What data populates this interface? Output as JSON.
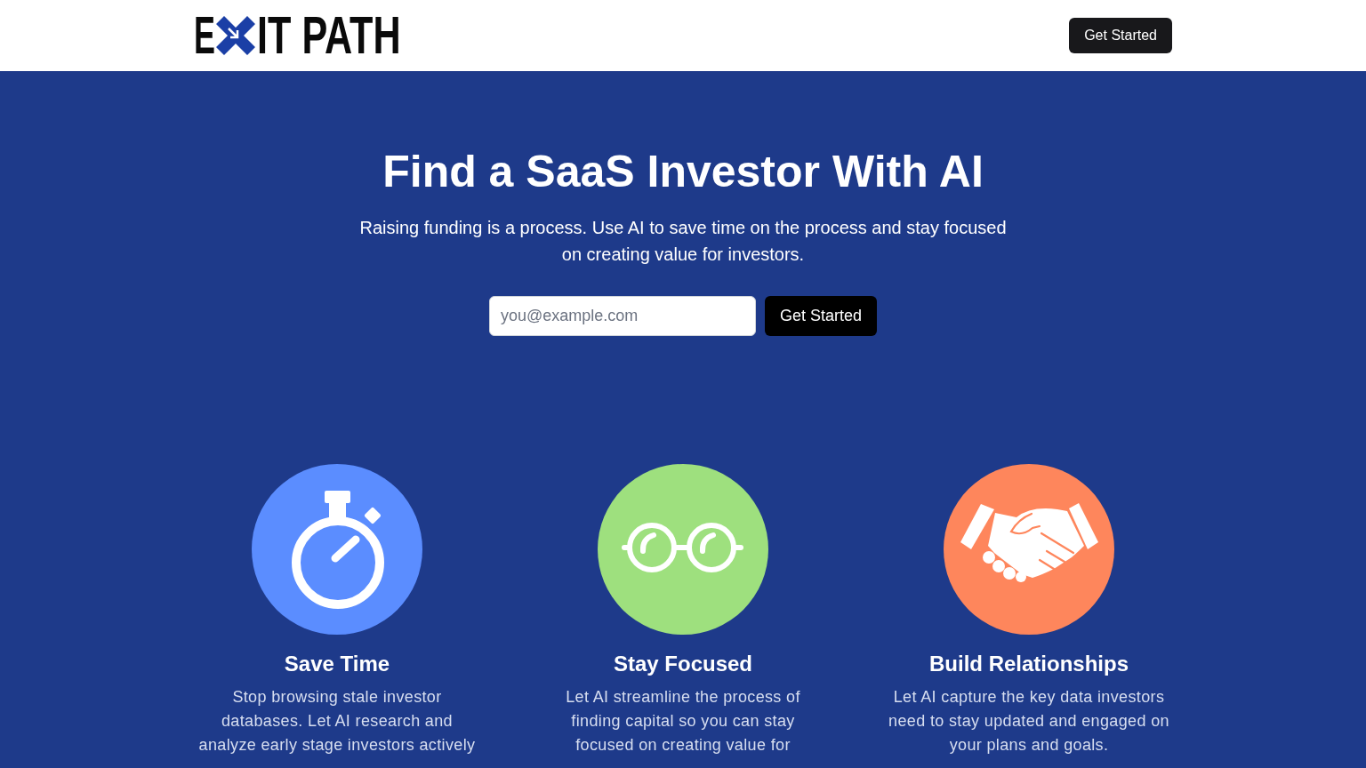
{
  "header": {
    "logo": {
      "text_start": "E",
      "text_end": "IT PATH"
    },
    "button": "Get Started"
  },
  "hero": {
    "title": "Find a SaaS Investor With AI",
    "subtitle": "Raising funding is a process. Use AI to save time on the process and stay focused on creating value for investors.",
    "email_field": {
      "placeholder": "you@example.com"
    },
    "button": "Get Started"
  },
  "features": [
    {
      "kind": "stopwatch",
      "color": "#5b8dff",
      "title": "Save Time",
      "description": "Stop browsing stale investor databases. Let AI research and analyze early stage investors actively"
    },
    {
      "kind": "glasses",
      "color": "#9ee07e",
      "title": "Stay Focused",
      "description": "Let AI streamline the process of finding capital so you can stay focused on creating value for"
    },
    {
      "kind": "handshake",
      "color": "#fe865c",
      "title": "Build Relationships",
      "description": "Let AI capture the key data investors need to stay updated and engaged on your plans and goals."
    }
  ]
}
